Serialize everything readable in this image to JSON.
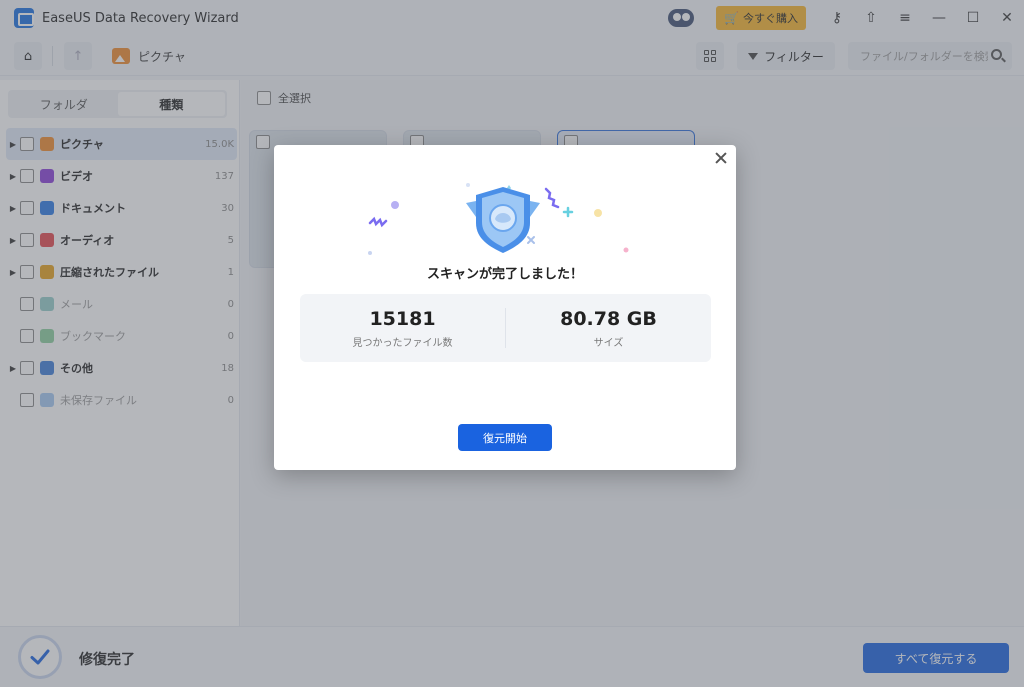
{
  "app": {
    "title": "EaseUS Data Recovery Wizard"
  },
  "titlebar": {
    "buy_label": "今すぐ購入"
  },
  "toolbar": {
    "breadcrumb": "ピクチャ",
    "filter_label": "フィルター",
    "search_placeholder": "ファイル/フォルダーを検索"
  },
  "sidebar": {
    "tabs": [
      {
        "label": "フォルダ",
        "active": false
      },
      {
        "label": "種類",
        "active": true
      }
    ],
    "items": [
      {
        "label": "ピクチャ",
        "count": "15.0K",
        "expandable": true,
        "icon": "image-icon",
        "color": "#f08a2c"
      },
      {
        "label": "ビデオ",
        "count": "137",
        "expandable": true,
        "icon": "video-icon",
        "color": "#8a3fd9"
      },
      {
        "label": "ドキュメント",
        "count": "30",
        "expandable": true,
        "icon": "document-icon",
        "color": "#2d7be6"
      },
      {
        "label": "オーディオ",
        "count": "5",
        "expandable": true,
        "icon": "audio-icon",
        "color": "#e5484d"
      },
      {
        "label": "圧縮されたファイル",
        "count": "1",
        "expandable": true,
        "icon": "archive-icon",
        "color": "#e8a21c"
      },
      {
        "label": "メール",
        "count": "0",
        "expandable": false,
        "icon": "mail-icon",
        "color": "#3fa6a0"
      },
      {
        "label": "ブックマーク",
        "count": "0",
        "expandable": false,
        "icon": "bookmark-icon",
        "color": "#2fa84f"
      },
      {
        "label": "その他",
        "count": "18",
        "expandable": true,
        "icon": "folder-icon",
        "color": "#3f7fd9"
      },
      {
        "label": "未保存ファイル",
        "count": "0",
        "expandable": false,
        "icon": "unsaved-file-icon",
        "color": "#5a9be8"
      }
    ]
  },
  "main": {
    "select_all_label": "全選択"
  },
  "modal": {
    "title": "スキャンが完了しました！",
    "files_found_value": "15181",
    "files_found_label": "見つかったファイル数",
    "size_value": "80.78 GB",
    "size_label": "サイズ",
    "start_button": "復元開始"
  },
  "footer": {
    "status": "修復完了",
    "restore_all_button": "すべて復元する"
  },
  "colors": {
    "accent": "#1a63e0",
    "buy": "#f7b52c",
    "selected_row": "#e1e9f7"
  }
}
